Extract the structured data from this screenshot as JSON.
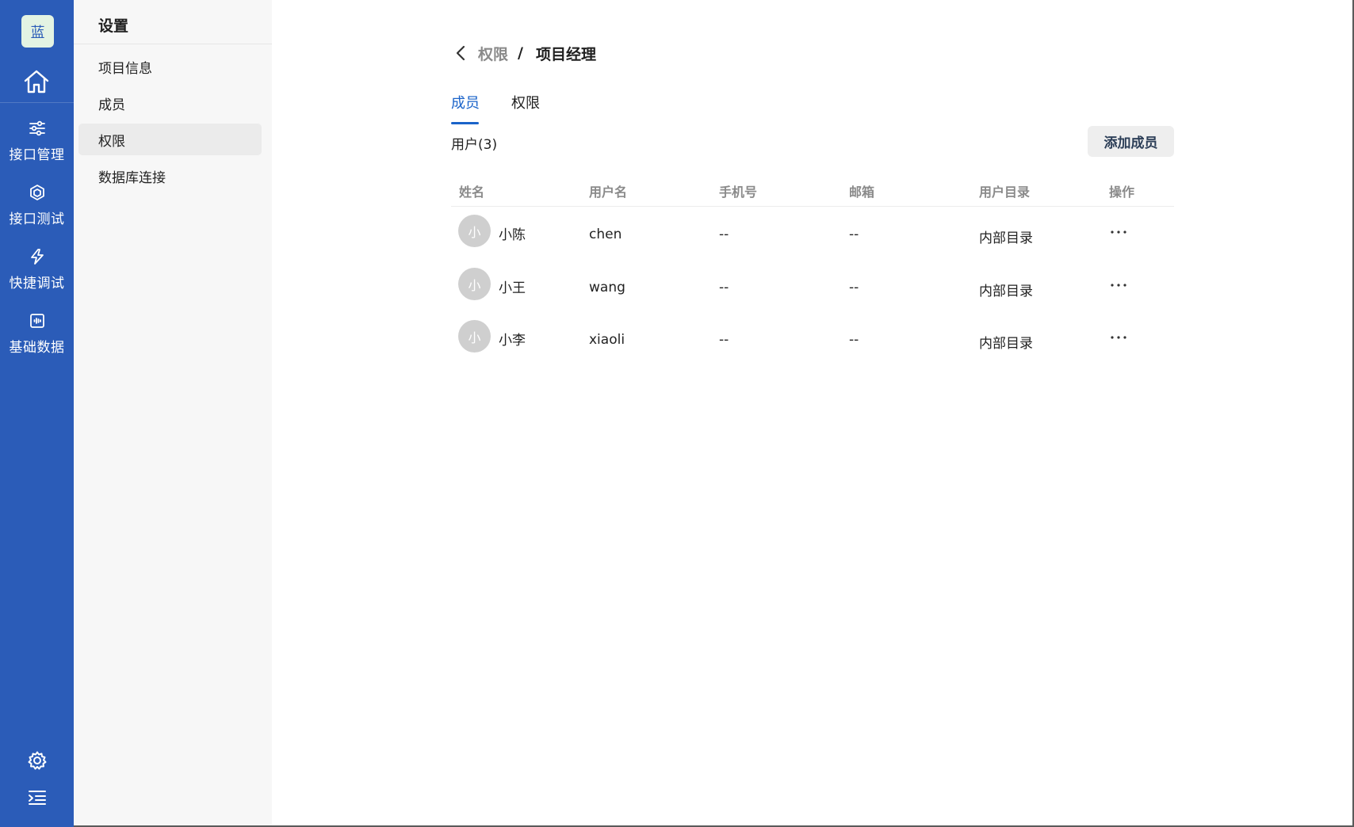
{
  "rail": {
    "logo": "蓝",
    "items": [
      {
        "label": "接口管理",
        "icon": "sliders-icon"
      },
      {
        "label": "接口测试",
        "icon": "cube-icon"
      },
      {
        "label": "快捷调试",
        "icon": "lightning-icon"
      },
      {
        "label": "基础数据",
        "icon": "data-icon"
      }
    ]
  },
  "sidebar": {
    "title": "设置",
    "items": [
      {
        "label": "项目信息"
      },
      {
        "label": "成员"
      },
      {
        "label": "权限"
      },
      {
        "label": "数据库连接"
      }
    ]
  },
  "breadcrumb": {
    "parent": "权限",
    "separator": "/",
    "current": "项目经理"
  },
  "tabs": [
    {
      "label": "成员"
    },
    {
      "label": "权限"
    }
  ],
  "users": {
    "count_label": "用户(3)",
    "add_button": "添加成员"
  },
  "table": {
    "headers": [
      "姓名",
      "用户名",
      "手机号",
      "邮箱",
      "用户目录",
      "操作"
    ],
    "rows": [
      {
        "avatar": "小",
        "name": "小陈",
        "username": "chen",
        "phone": "--",
        "email": "--",
        "directory": "内部目录"
      },
      {
        "avatar": "小",
        "name": "小王",
        "username": "wang",
        "phone": "--",
        "email": "--",
        "directory": "内部目录"
      },
      {
        "avatar": "小",
        "name": "小李",
        "username": "xiaoli",
        "phone": "--",
        "email": "--",
        "directory": "内部目录"
      }
    ]
  },
  "colors": {
    "rail_bg": "#2b5cb8",
    "accent": "#1a63c9"
  }
}
